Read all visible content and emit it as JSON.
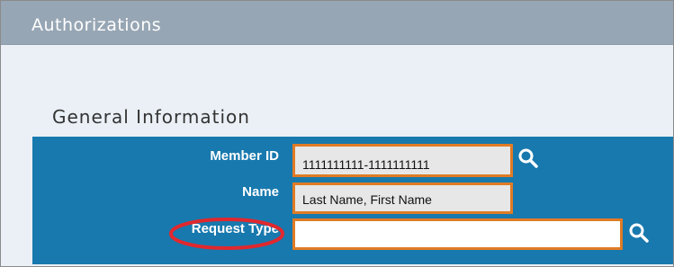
{
  "header": {
    "title": "Authorizations"
  },
  "section": {
    "title": "General Information"
  },
  "form": {
    "member_id": {
      "label": "Member ID",
      "value": "1111111111-1111111111"
    },
    "name": {
      "label": "Name",
      "value": "Last Name, First Name"
    },
    "request_type": {
      "label": "Request Type",
      "value": ""
    }
  },
  "icons": {
    "member_search": "search-icon",
    "request_type_search": "search-icon"
  },
  "colors": {
    "header_bar": "#97a6b4",
    "panel": "#1879ae",
    "field_border": "#e07b25",
    "highlight": "#e0282e",
    "page_background": "#eaf0f6"
  }
}
